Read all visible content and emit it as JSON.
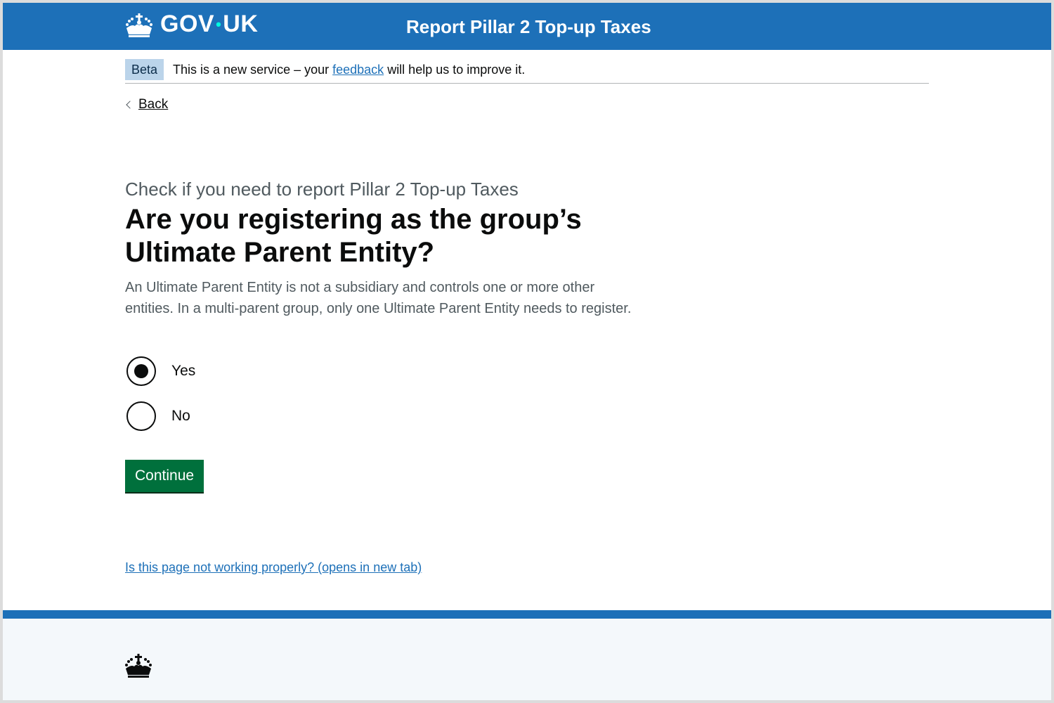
{
  "header": {
    "logo_text_left": "GOV",
    "logo_separator": "•",
    "logo_text_right": "UK",
    "service_name": "Report Pillar 2 Top-up Taxes",
    "logo_icon": "crown-icon"
  },
  "phase_banner": {
    "tag": "Beta",
    "text_before": "This is a new service – your ",
    "link_text": "feedback",
    "text_after": " will help us to improve it."
  },
  "back_link": {
    "label": "Back",
    "icon": "chevron-left-icon"
  },
  "main": {
    "caption": "Check if you need to report Pillar 2 Top-up Taxes",
    "heading": "Are you registering as the group’s Ultimate Parent Entity?",
    "hint": "An Ultimate Parent Entity is not a subsidiary and controls one or more other entities. In a multi-parent group, only one Ultimate Parent Entity needs to register.",
    "options": [
      {
        "label": "Yes",
        "selected": true
      },
      {
        "label": "No",
        "selected": false
      }
    ],
    "continue_label": "Continue",
    "problem_link": "Is this page not working properly? (opens in new tab)"
  },
  "footer": {
    "icon": "crown-icon"
  },
  "colors": {
    "brand_blue": "#1d70b8",
    "button_green": "#00703c",
    "text": "#0b0c0c",
    "secondary_text": "#505a5f",
    "footer_bg": "#f4f8fb"
  }
}
